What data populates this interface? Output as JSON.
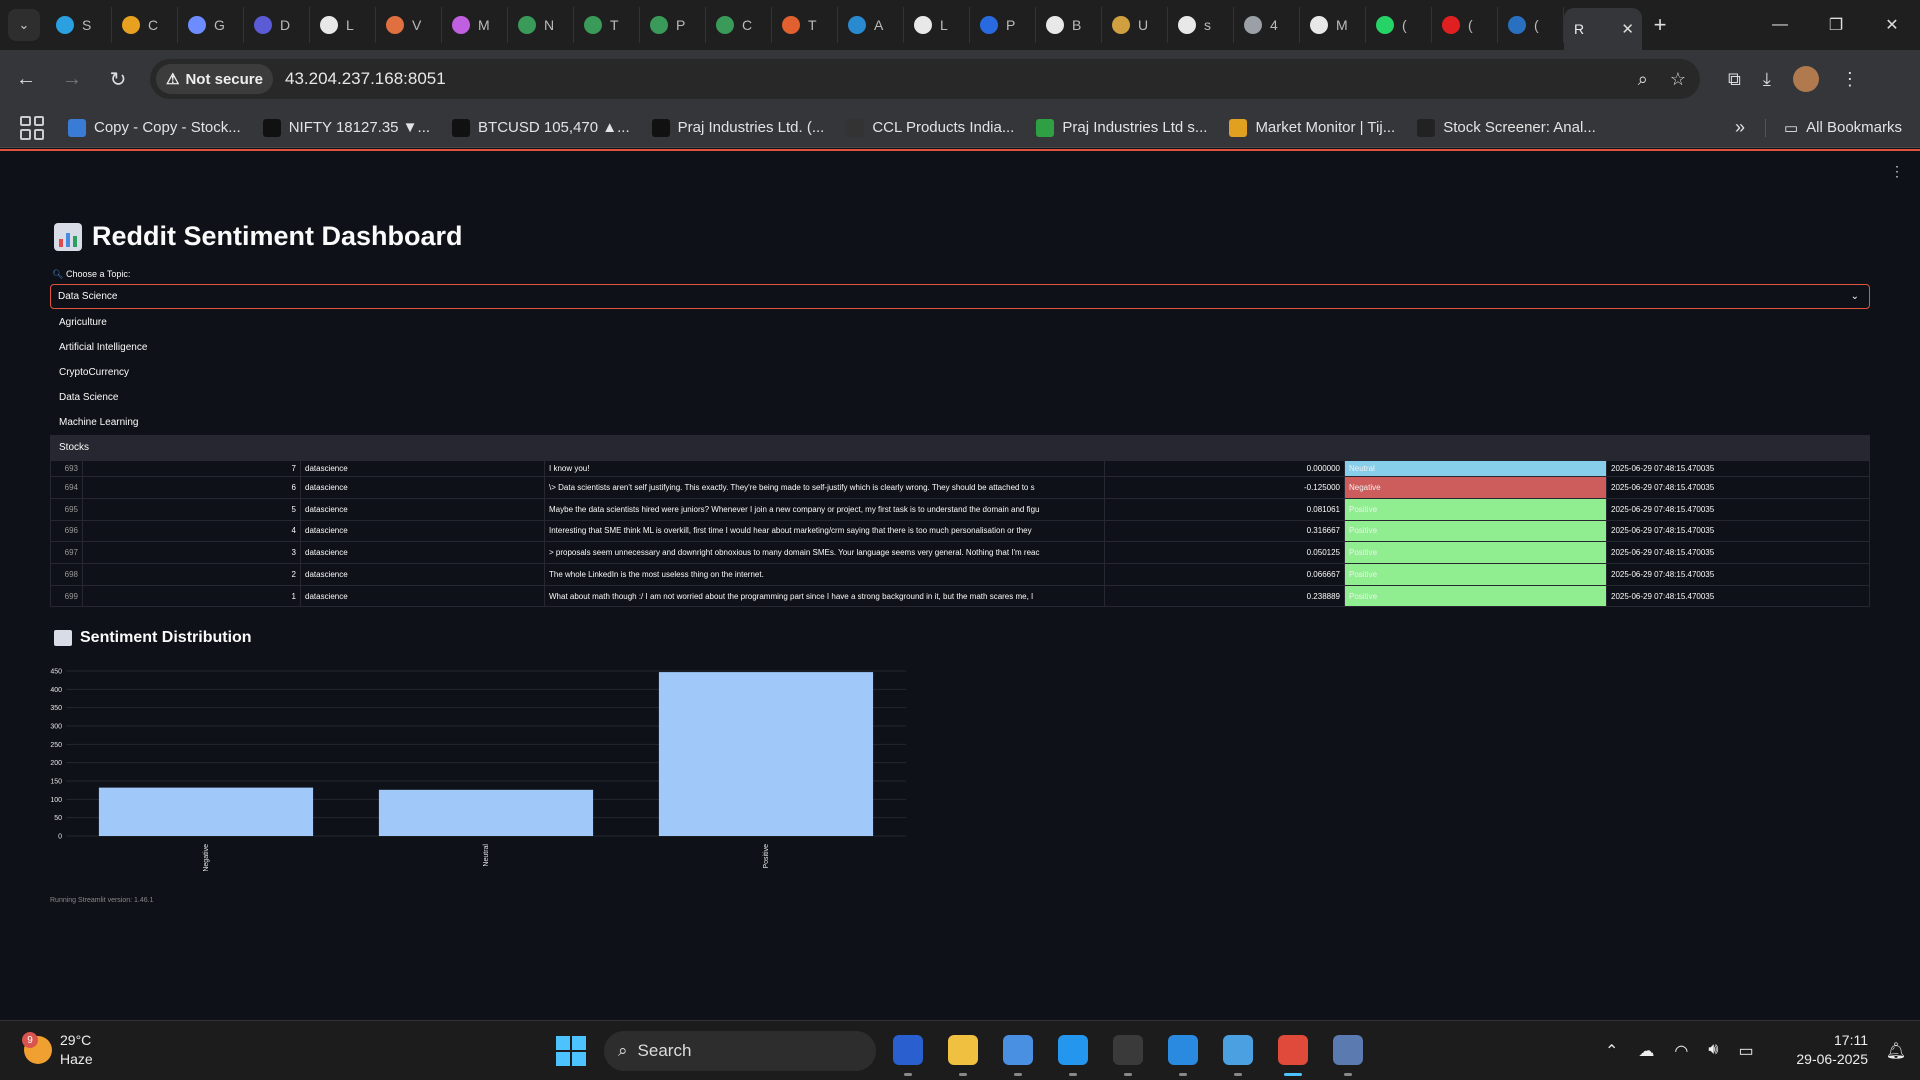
{
  "browser": {
    "tabs": [
      {
        "letter": "S",
        "color": "#2aa0e0"
      },
      {
        "letter": "C",
        "color": "#e8a020"
      },
      {
        "letter": "G",
        "color": "#6c8cff"
      },
      {
        "letter": "D",
        "color": "#5b5bd6"
      },
      {
        "letter": "L",
        "color": "#e8e8e8"
      },
      {
        "letter": "V",
        "color": "#e07040"
      },
      {
        "letter": "M",
        "color": "#c060e0"
      },
      {
        "letter": "N",
        "color": "#3a9a5a"
      },
      {
        "letter": "T",
        "color": "#3a9a5a"
      },
      {
        "letter": "P",
        "color": "#3a9a5a"
      },
      {
        "letter": "C",
        "color": "#3a9a5a"
      },
      {
        "letter": "T",
        "color": "#e06030"
      },
      {
        "letter": "A",
        "color": "#2a8ad0"
      },
      {
        "letter": "L",
        "color": "#e8e8e8"
      },
      {
        "letter": "P",
        "color": "#2a6ae0"
      },
      {
        "letter": "B",
        "color": "#e8e8e8"
      },
      {
        "letter": "U",
        "color": "#d0a040"
      },
      {
        "letter": "s",
        "color": "#e8e8e8"
      },
      {
        "letter": "4",
        "color": "#9aa0a6"
      },
      {
        "letter": "M",
        "color": "#e8e8e8"
      },
      {
        "letter": "(",
        "color": "#25d366"
      },
      {
        "letter": "(",
        "color": "#e02020"
      },
      {
        "letter": "(",
        "color": "#2a70c0"
      }
    ],
    "active_tab": {
      "label": "R",
      "close": "✕"
    },
    "new_tab": "+",
    "window_controls": {
      "minimize": "—",
      "restore": "❐",
      "close": "✕"
    },
    "security_chip": "Not secure",
    "url": "43.204.237.168:8051",
    "bookmarks": [
      {
        "label": "Copy - Copy - Stock...",
        "color": "#3a7bd5"
      },
      {
        "label": "NIFTY 18127.35 ▼...",
        "color": "#111111"
      },
      {
        "label": "BTCUSD 105,470 ▲...",
        "color": "#111111"
      },
      {
        "label": "Praj Industries Ltd. (...",
        "color": "#111111"
      },
      {
        "label": "CCL Products India...",
        "color": "#333333"
      },
      {
        "label": "Praj Industries Ltd s...",
        "color": "#2ea043"
      },
      {
        "label": "Market Monitor | Tij...",
        "color": "#e0a020"
      },
      {
        "label": "Stock Screener: Anal...",
        "color": "#222222"
      }
    ],
    "bookmarks_more": "»",
    "all_bookmarks": "All Bookmarks"
  },
  "app": {
    "title": "Reddit Sentiment Dashboard",
    "topic_label": "Choose a Topic:",
    "selected_topic": "Data Science",
    "topic_options": [
      "Agriculture",
      "Artificial Intelligence",
      "CryptoCurrency",
      "Data Science",
      "Machine Learning",
      "Stocks"
    ],
    "highlighted_option": "Stocks",
    "table_rows": [
      {
        "idx": "693",
        "num": "7",
        "subreddit": "datascience",
        "text": "I know you!",
        "score": "0.000000",
        "sentiment": "Neutral",
        "color": "#87ceeb",
        "ts": "2025-06-29 07:48:15.470035"
      },
      {
        "idx": "694",
        "num": "6",
        "subreddit": "datascience",
        "text": "\\> Data scientists aren't self justifying.  This exactly. They're being made to self-justify which is clearly wrong. They should be attached to s",
        "score": "-0.125000",
        "sentiment": "Negative",
        "color": "#cd5c5c",
        "ts": "2025-06-29 07:48:15.470035"
      },
      {
        "idx": "695",
        "num": "5",
        "subreddit": "datascience",
        "text": "Maybe the data scientists hired were juniors? Whenever I join a new company or project, my first task is to understand the domain and figu",
        "score": "0.081061",
        "sentiment": "Positive",
        "color": "#90ee90",
        "ts": "2025-06-29 07:48:15.470035"
      },
      {
        "idx": "696",
        "num": "4",
        "subreddit": "datascience",
        "text": "Interesting that SME think ML is overkill, first time I would hear about marketing/crm saying that there is too much personalisation or they",
        "score": "0.316667",
        "sentiment": "Positive",
        "color": "#90ee90",
        "ts": "2025-06-29 07:48:15.470035"
      },
      {
        "idx": "697",
        "num": "3",
        "subreddit": "datascience",
        "text": "> proposals seem unnecessary and downright obnoxious to many domain SMEs.  Your language seems very general. Nothing that I'm reac",
        "score": "0.050125",
        "sentiment": "Positive",
        "color": "#90ee90",
        "ts": "2025-06-29 07:48:15.470035"
      },
      {
        "idx": "698",
        "num": "2",
        "subreddit": "datascience",
        "text": "The whole LinkedIn is the most useless thing on the internet.",
        "score": "0.066667",
        "sentiment": "Positive",
        "color": "#90ee90",
        "ts": "2025-06-29 07:48:15.470035"
      },
      {
        "idx": "699",
        "num": "1",
        "subreddit": "datascience",
        "text": "What about math though :/  I am not worried about the programming part since I have a strong background in it, but the math scares me, I",
        "score": "0.238889",
        "sentiment": "Positive",
        "color": "#90ee90",
        "ts": "2025-06-29 07:48:15.470035"
      }
    ],
    "chart_heading": "Sentiment Distribution",
    "footer": "Running Streamlit version: 1.46.1"
  },
  "chart_data": {
    "type": "bar",
    "categories": [
      "Negative",
      "Neutral",
      "Positive"
    ],
    "values": [
      132,
      126,
      447
    ],
    "yticks": [
      0,
      50,
      100,
      150,
      200,
      250,
      300,
      350,
      400,
      450
    ],
    "ylim": [
      0,
      450
    ],
    "bar_color": "#a0c8f8",
    "grid": true
  },
  "taskbar": {
    "temperature": "29°C",
    "condition": "Haze",
    "weather_badge": "9",
    "search_label": "Search",
    "time": "17:11",
    "date": "29-06-2025",
    "apps": [
      {
        "name": "app-tracker",
        "color": "#2a5fd0"
      },
      {
        "name": "file-explorer",
        "color": "#f0c040"
      },
      {
        "name": "chrome-profile",
        "color": "#4a90e2"
      },
      {
        "name": "docker",
        "color": "#2496ed"
      },
      {
        "name": "terminal",
        "color": "#3a3a3a"
      },
      {
        "name": "vscode",
        "color": "#2a8ae0"
      },
      {
        "name": "notepad",
        "color": "#4aa0e0"
      },
      {
        "name": "chrome",
        "color": "#e04a3a"
      },
      {
        "name": "postgres",
        "color": "#5a7ab0"
      }
    ]
  }
}
